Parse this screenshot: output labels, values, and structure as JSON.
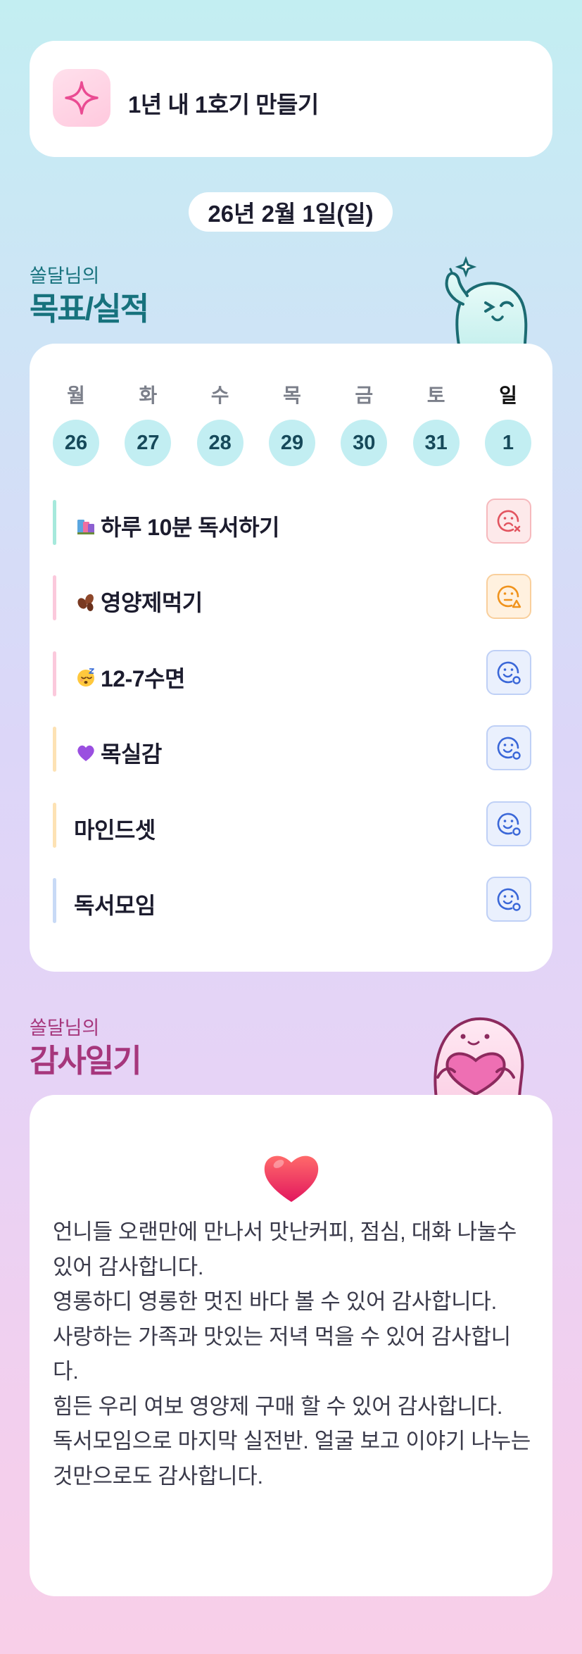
{
  "goal": {
    "icon": "sparkle-icon",
    "text": "1년 내 1호기 만들기"
  },
  "date": "26년 2월 1일(일)",
  "tracker_section": {
    "subtitle": "쏠달님의",
    "title": "목표/실적",
    "mascot": "waving-ghost-mascot"
  },
  "week": {
    "days": [
      {
        "name": "월",
        "num": "26"
      },
      {
        "name": "화",
        "num": "27"
      },
      {
        "name": "수",
        "num": "28"
      },
      {
        "name": "목",
        "num": "29"
      },
      {
        "name": "금",
        "num": "30"
      },
      {
        "name": "토",
        "num": "31"
      },
      {
        "name": "일",
        "num": "1"
      }
    ],
    "today_index": 6
  },
  "habits": [
    {
      "emoji": "books-emoji",
      "label": "하루 10분 독서하기",
      "bar_color": "#a6e9dc",
      "status": "fail"
    },
    {
      "emoji": "beans-emoji",
      "label": "영양제먹기",
      "bar_color": "#fbc9dc",
      "status": "warn"
    },
    {
      "emoji": "sleeping-face-emoji",
      "label": "12-7수면",
      "bar_color": "#fbc9dc",
      "status": "ok"
    },
    {
      "emoji": "purple-heart-emoji",
      "label": "목실감",
      "bar_color": "#fde2b4",
      "status": "ok"
    },
    {
      "emoji": "",
      "label": "마인드셋",
      "bar_color": "#fde2b4",
      "status": "ok"
    },
    {
      "emoji": "",
      "label": "독서모임",
      "bar_color": "#c8daf6",
      "status": "ok"
    }
  ],
  "gratitude_section": {
    "subtitle": "쏠달님의",
    "title": "감사일기",
    "mascot": "heart-holding-ghost-mascot"
  },
  "diary": {
    "icon": "red-heart-icon",
    "text": "언니들 오랜만에 만나서 맛난커피, 점심, 대화 나눌수 있어 감사합니다.\n영롱하디 영롱한 멋진 바다 볼 수 있어 감사합니다.\n사랑하는 가족과 맛있는 저녁 먹을 수 있어 감사합니다.\n힘든 우리 여보 영양제 구매 할 수 있어 감사합니다.\n독서모임으로 마지막 실전반. 얼굴 보고 이야기 나누는 것만으로도 감사합니다."
  },
  "colors": {
    "accent_teal": "#17727d",
    "accent_plum": "#a6367c",
    "day_circle": "#c2eef2"
  }
}
